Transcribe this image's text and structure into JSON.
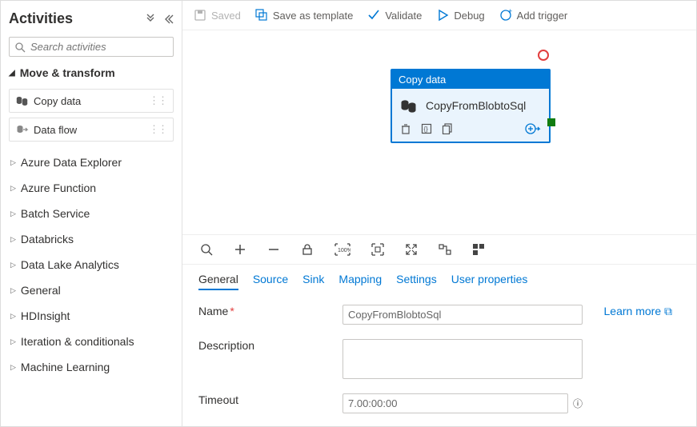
{
  "sidebar": {
    "title": "Activities",
    "search_placeholder": "Search activities",
    "section": "Move & transform",
    "activities": [
      {
        "label": "Copy data"
      },
      {
        "label": "Data flow"
      }
    ],
    "tree": [
      "Azure Data Explorer",
      "Azure Function",
      "Batch Service",
      "Databricks",
      "Data Lake Analytics",
      "General",
      "HDInsight",
      "Iteration & conditionals",
      "Machine Learning"
    ]
  },
  "toolbar": {
    "saved": "Saved",
    "save_template": "Save as template",
    "validate": "Validate",
    "debug": "Debug",
    "add_trigger": "Add trigger"
  },
  "node": {
    "header": "Copy data",
    "name": "CopyFromBlobtoSql"
  },
  "tabs": [
    "General",
    "Source",
    "Sink",
    "Mapping",
    "Settings",
    "User properties"
  ],
  "form": {
    "name_label": "Name",
    "name_value": "CopyFromBlobtoSql",
    "desc_label": "Description",
    "desc_value": "",
    "timeout_label": "Timeout",
    "timeout_value": "7.00:00:00",
    "learn_more": "Learn more"
  }
}
